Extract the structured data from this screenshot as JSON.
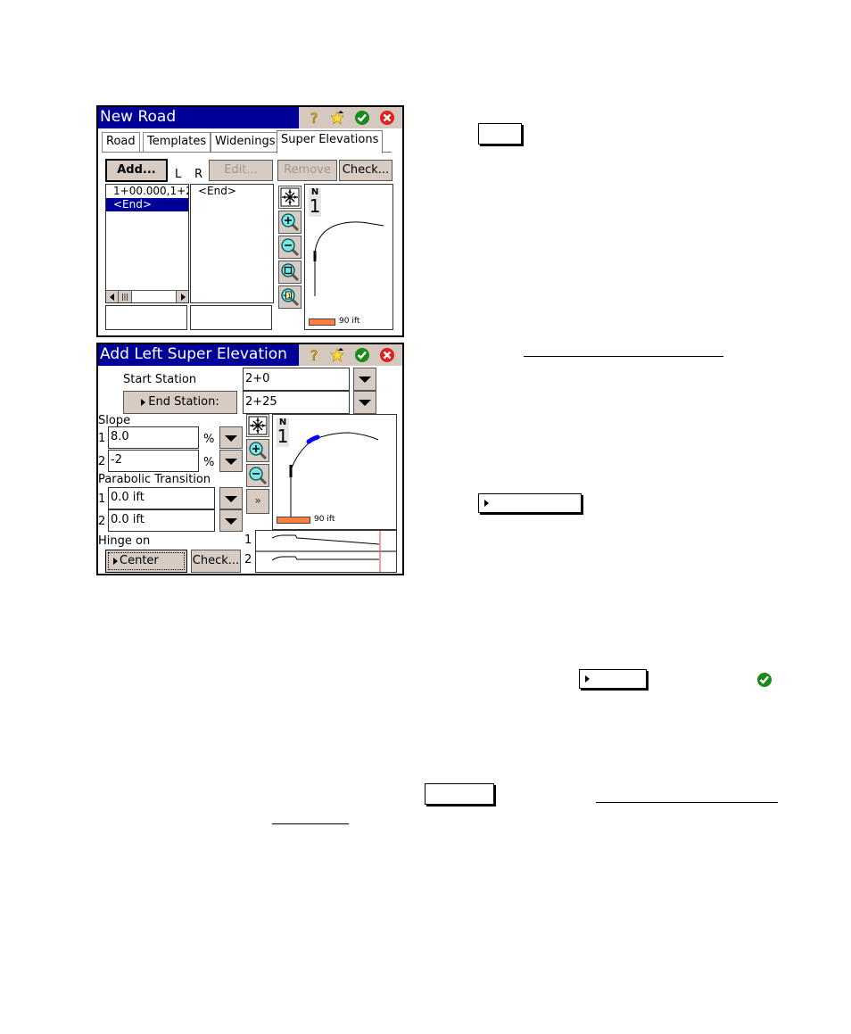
{
  "new_road_window": {
    "title": "New Road",
    "title_icons": [
      "help-icon",
      "favorites-star-icon",
      "ok-check-icon",
      "close-x-icon"
    ],
    "tabs": [
      {
        "label": "Road",
        "active": false
      },
      {
        "label": "Templates",
        "active": false
      },
      {
        "label": "Widenings",
        "active": false
      },
      {
        "label": "Super Elevations",
        "active": true
      }
    ],
    "buttons": {
      "add": "Add...",
      "edit": "Edit...",
      "remove": "Remove",
      "check": "Check..."
    },
    "column_labels": {
      "left": "L",
      "right": "R"
    },
    "left_list": [
      "1+00.000,1+2",
      "<End>"
    ],
    "left_list_selected": 1,
    "right_list": [
      "<End>"
    ],
    "map": {
      "north_label": "N",
      "north_digit": "1",
      "scale_label": "90 ift",
      "tools": [
        "zoom-extents-icon",
        "zoom-in-icon",
        "zoom-out-icon",
        "zoom-window-icon",
        "zoom-to-item-icon"
      ]
    }
  },
  "add_left_window": {
    "title": "Add Left Super Elevation",
    "title_icons": [
      "help-icon",
      "favorites-star-icon",
      "ok-check-icon",
      "close-x-icon"
    ],
    "start_station_label": "Start Station",
    "start_station_value": "2+0",
    "end_station_button": "End Station:",
    "end_station_value": "2+25",
    "slope_label": "Slope",
    "slope_rows": [
      {
        "index": "1",
        "value": "8.0",
        "unit": "%"
      },
      {
        "index": "2",
        "value": "-2",
        "unit": "%"
      }
    ],
    "parabolic_label": "Parabolic Transition",
    "parabolic_rows": [
      {
        "index": "1",
        "value": "0.0 ift"
      },
      {
        "index": "2",
        "value": "0.0 ift"
      }
    ],
    "hinge_label": "Hinge on",
    "hinge_button": "Center",
    "check_button": "Check...",
    "map": {
      "north_label": "N",
      "north_digit": "1",
      "scale_label": "90 ift",
      "more_button": "»",
      "tools": [
        "zoom-extents-icon",
        "zoom-in-icon",
        "zoom-out-icon"
      ]
    },
    "profile_rows": [
      "1",
      "2"
    ],
    "colors": {
      "highlight": "#0000ff",
      "station_marker": "#ff6060"
    }
  },
  "document": {
    "colors": {
      "title_bar": "#000099",
      "button_face": "#d6ccc4",
      "scale_bar": "#ff7f40"
    }
  }
}
